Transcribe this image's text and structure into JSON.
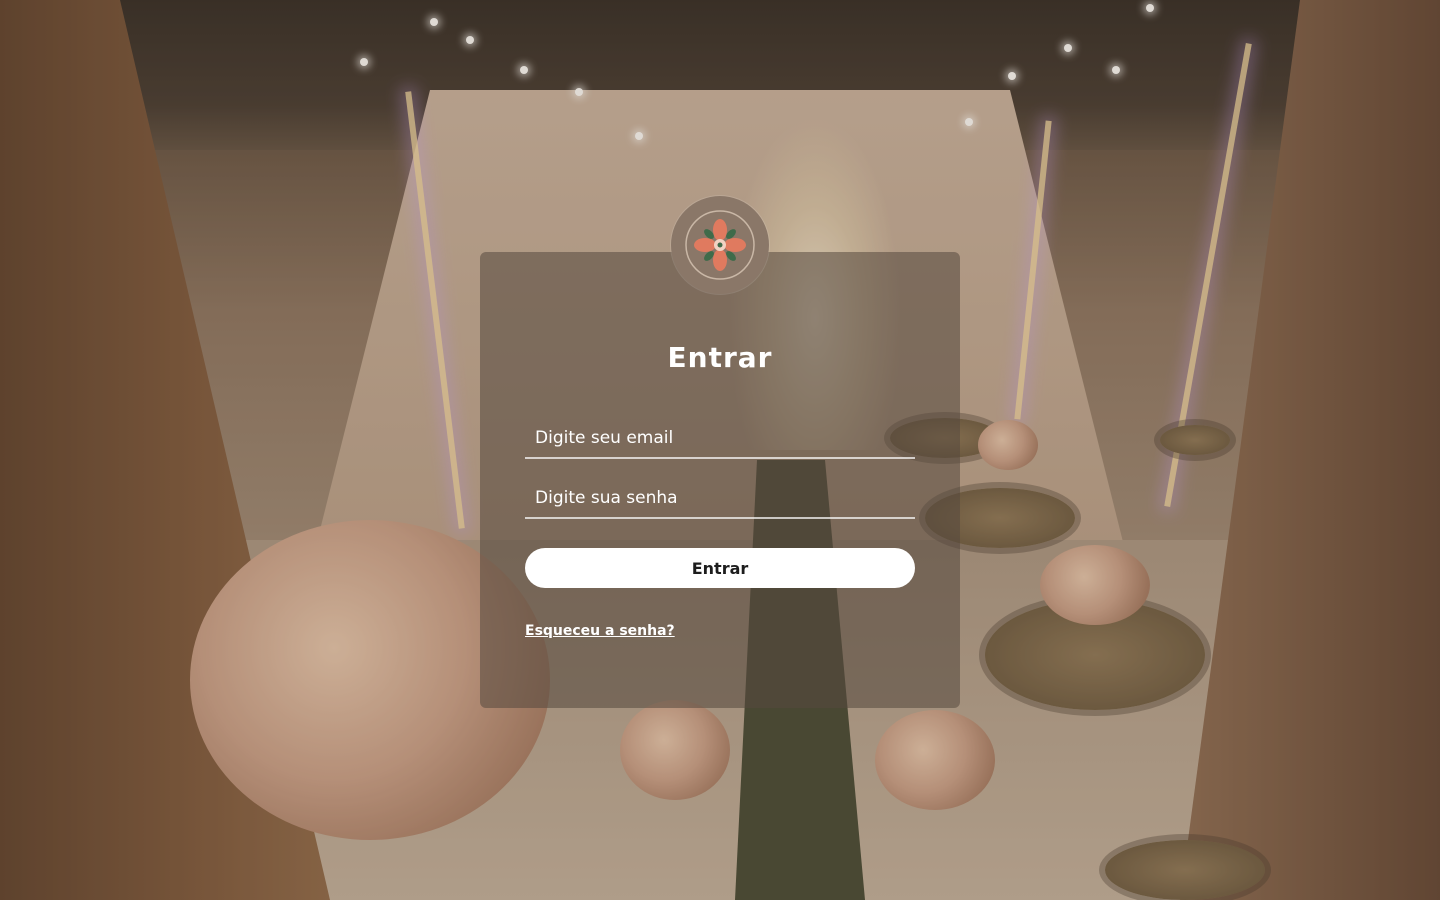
{
  "login": {
    "title": "Entrar",
    "email_placeholder": "Digite seu email",
    "password_placeholder": "Digite sua senha",
    "submit_label": "Entrar",
    "forgot_password_link": "Esqueceu a senha?"
  },
  "logo": {
    "icon": "floral-emblem-icon",
    "colors": [
      "#e07a5f",
      "#3f6b4a",
      "#8a7768"
    ]
  },
  "colors": {
    "card_background": "rgba(85,72,62,0.55)",
    "text": "#ffffff",
    "button_background": "#ffffff",
    "button_text": "#1d1d1d"
  }
}
